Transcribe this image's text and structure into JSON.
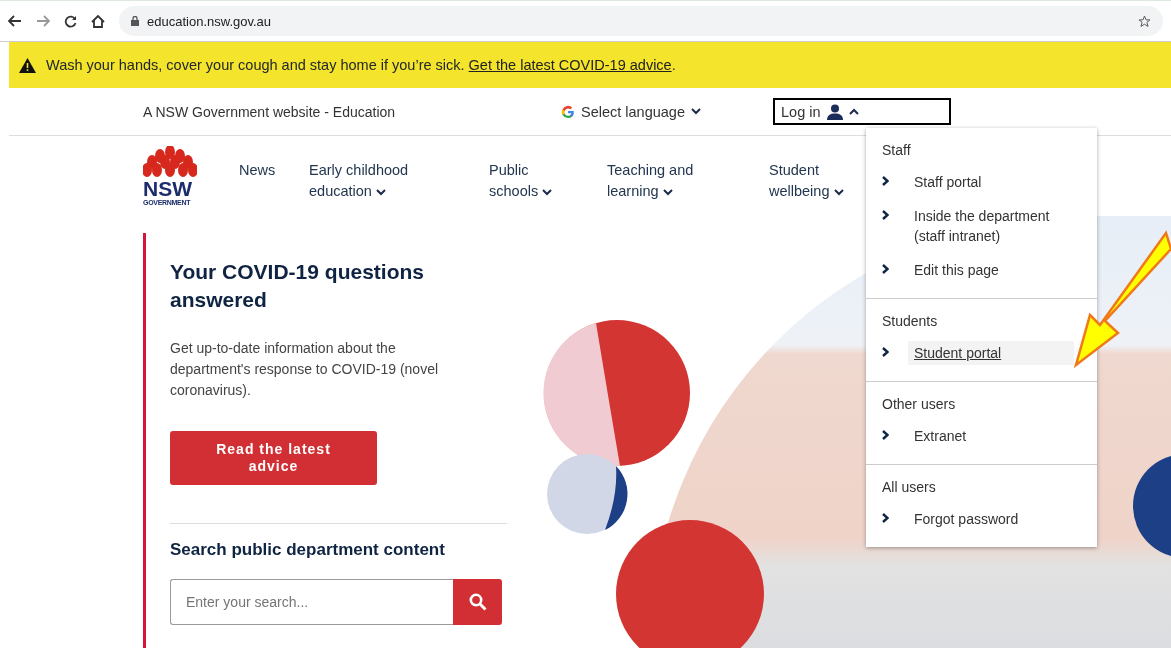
{
  "browser": {
    "url": "education.nsw.gov.au"
  },
  "alert": {
    "message": "Wash your hands, cover your cough and stay home if you’re sick. ",
    "link": "Get the latest COVID-19 advice",
    "suffix": "."
  },
  "top_bar": {
    "site_label": "A NSW Government website - Education",
    "language": "Select language",
    "login": "Log in",
    "login_expanded": true
  },
  "logo": {
    "text": "NSW",
    "subtext": "GOVERNMENT"
  },
  "nav": [
    {
      "label": "News",
      "dropdown": false
    },
    {
      "label": "Early childhood education",
      "dropdown": true
    },
    {
      "label": "Public schools",
      "dropdown": true
    },
    {
      "label": "Teaching and learning",
      "dropdown": true
    },
    {
      "label": "Student wellbeing",
      "dropdown": true
    }
  ],
  "covid": {
    "heading": "Your COVID-19 questions answered",
    "body": "Get up-to-date information about the department's response to COVID-19 (novel coronavirus).",
    "button": "Read the latest advice"
  },
  "search": {
    "heading": "Search public department content",
    "placeholder": "Enter your search..."
  },
  "login_menu": [
    {
      "label": "Staff",
      "items": [
        {
          "label": "Staff portal",
          "selected": false
        },
        {
          "label": "Inside the department (staff intranet)",
          "selected": false
        },
        {
          "label": "Edit this page",
          "selected": false
        }
      ]
    },
    {
      "label": "Students",
      "items": [
        {
          "label": "Student portal",
          "selected": true
        }
      ]
    },
    {
      "label": "Other users",
      "items": [
        {
          "label": "Extranet",
          "selected": false
        }
      ]
    },
    {
      "label": "All users",
      "items": [
        {
          "label": "Forgot password",
          "selected": false
        }
      ]
    }
  ]
}
